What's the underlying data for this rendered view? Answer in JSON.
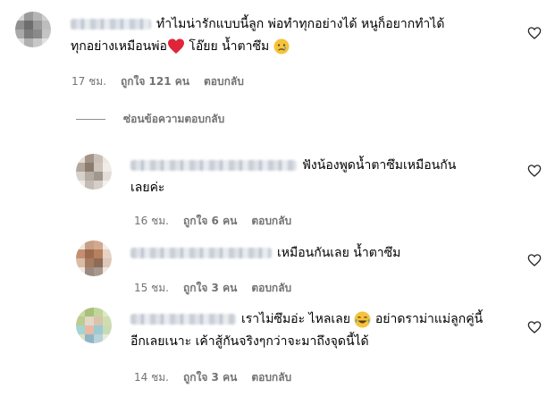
{
  "main_comment": {
    "text_line1": "ทำไมน่ารักแบบนี้ลูก พ่อทำทุกอย่างได้ หนูก็อยากทำได้",
    "text_line2_a": "ทุกอย่างเหมือนพ่อ",
    "text_line2_b": " โอ๊ยย น้ำตาซึม",
    "time": "17 ชม.",
    "likes": "ถูกใจ 121 คน",
    "reply": "ตอบกลับ"
  },
  "hide_replies_label": "ซ่อนข้อความตอบกลับ",
  "replies": [
    {
      "text_line1": "ฟังน้องพูดน้ำตาซึมเหมือนกัน",
      "text_line2": "เลยค่ะ",
      "time": "16 ชม.",
      "likes": "ถูกใจ 6 คน",
      "reply": "ตอบกลับ"
    },
    {
      "text_line1": "เหมือนกันเลย น้ำตาซึม",
      "time": "15 ชม.",
      "likes": "ถูกใจ 3 คน",
      "reply": "ตอบกลับ"
    },
    {
      "text_line1_a": "เราไม่ซึมอ่ะ ไหลเลย",
      "text_line1_b": " อย่าดราม่าแม่ลูกคู่นี้",
      "text_line2": "อีกเลยเนาะ เค้าสู้กันจริงๆกว่าจะมาถึงจุดนี้ได้",
      "time": "14 ชม.",
      "likes": "ถูกใจ 3 คน",
      "reply": "ตอบกลับ"
    }
  ],
  "icons": {
    "heart": "heart-outline-icon",
    "red_heart_emoji": "red-heart-emoji",
    "sad_emoji": "sad-face-emoji",
    "laughing_emoji": "tears-of-joy-emoji"
  },
  "colors": {
    "meta": "#737373",
    "text": "#000000",
    "emoji_heart": "#e0243a",
    "emoji_yellow": "#f5c33b"
  }
}
